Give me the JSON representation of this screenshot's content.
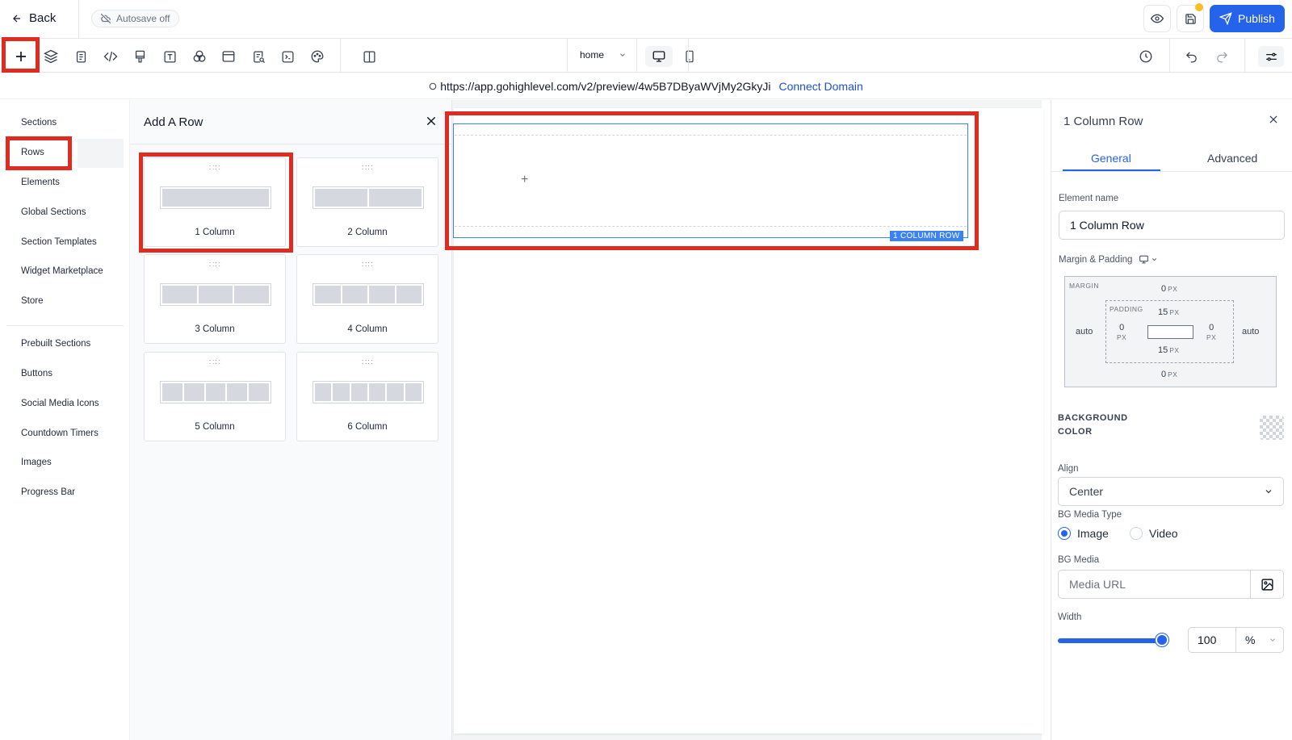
{
  "header": {
    "back_label": "Back",
    "autosave_label": "Autosave off",
    "publish_label": "Publish"
  },
  "toolbar": {
    "icons": [
      "add-icon",
      "layers-icon",
      "page-icon",
      "code-icon",
      "paint-icon",
      "text-icon",
      "shapes-icon",
      "template-icon",
      "search-page-icon",
      "terminal-icon",
      "palette-icon",
      "split-view-icon"
    ],
    "page_select": "home",
    "device_options": [
      "desktop",
      "mobile"
    ]
  },
  "url_bar": {
    "url": "https://app.gohighlevel.com/v2/preview/4w5B7DByaWVjMy2GkyJi",
    "connect_label": "Connect Domain"
  },
  "left_nav": {
    "items": [
      "Sections",
      "Rows",
      "Elements",
      "Global Sections",
      "Section Templates",
      "Widget Marketplace",
      "Store"
    ],
    "items2": [
      "Prebuilt Sections",
      "Buttons",
      "Social Media Icons",
      "Countdown Timers",
      "Images",
      "Progress Bar"
    ],
    "active": "Rows"
  },
  "row_panel": {
    "title": "Add A Row",
    "cards": [
      {
        "label": "1 Column",
        "cols": 1
      },
      {
        "label": "2 Column",
        "cols": 2
      },
      {
        "label": "3 Column",
        "cols": 3
      },
      {
        "label": "4 Column",
        "cols": 4
      },
      {
        "label": "5 Column",
        "cols": 5
      },
      {
        "label": "6 Column",
        "cols": 6
      }
    ]
  },
  "canvas": {
    "row_tag": "1 COLUMN ROW",
    "add_symbol": "+"
  },
  "right_panel": {
    "title": "1 Column Row",
    "tabs": [
      "General",
      "Advanced"
    ],
    "active_tab": "General",
    "element_name_label": "Element name",
    "element_name_value": "1 Column Row",
    "margin_padding_label": "Margin & Padding",
    "margin": {
      "label": "MARGIN",
      "top": "0",
      "bottom": "0",
      "left": "auto",
      "right": "auto",
      "unit": "PX"
    },
    "padding": {
      "label": "PADDING",
      "top": "15",
      "bottom": "15",
      "left": "0",
      "right": "0",
      "unit": "PX"
    },
    "background_color_label": "BACKGROUND COLOR",
    "align_label": "Align",
    "align_value": "Center",
    "bg_media_type_label": "BG Media Type",
    "bg_media_types": [
      "Image",
      "Video"
    ],
    "bg_media_type_selected": "Image",
    "bg_media_label": "BG Media",
    "bg_media_placeholder": "Media URL",
    "width_label": "Width",
    "width_value": "100",
    "width_unit": "%",
    "width_slider_fraction": 1.0
  },
  "colors": {
    "accent": "#2563eb",
    "highlight_box": "#e02b20",
    "autosave_dot": "#fbbf24"
  }
}
